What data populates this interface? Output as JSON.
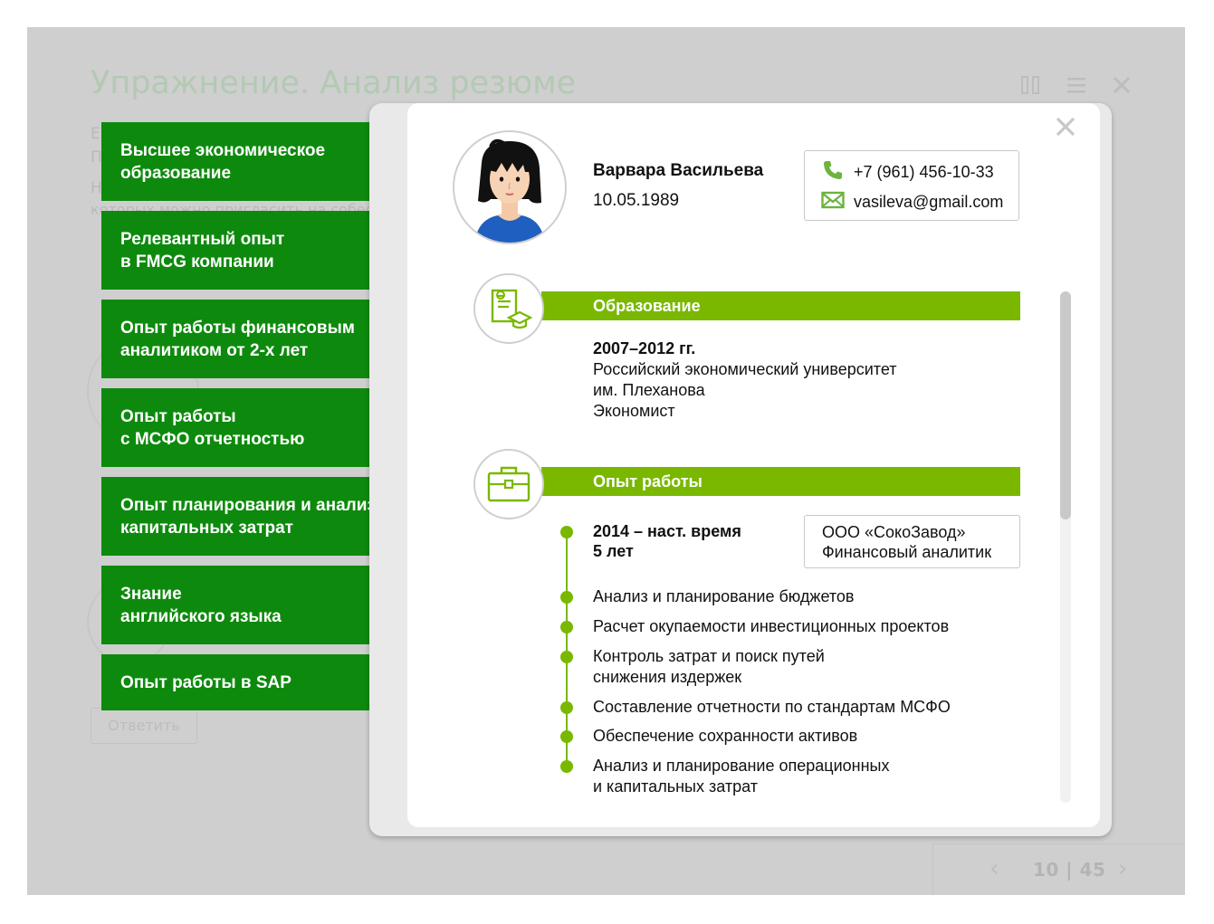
{
  "page": {
    "title": "Упражнение. Анализ резюме",
    "answer_button": "Ответить",
    "pager": "10 | 45",
    "background_text_fragments": [
      "Е",
      "П",
      "Н",
      "которых можно пригласить на собесе"
    ]
  },
  "criteria_cards": [
    {
      "lines": [
        "Высшее экономическое",
        "образование"
      ]
    },
    {
      "lines": [
        "Релевантный опыт",
        "в FMCG компании"
      ]
    },
    {
      "lines": [
        "Опыт работы финансовым",
        "аналитиком от 2-х лет"
      ]
    },
    {
      "lines": [
        "Опыт работы",
        "с МСФО отчетностью"
      ]
    },
    {
      "lines": [
        "Опыт планирования и анализа",
        "капитальных затрат"
      ]
    },
    {
      "lines": [
        "Знание",
        "английского языка"
      ]
    },
    {
      "lines": [
        "Опыт работы в SAP"
      ]
    }
  ],
  "resume": {
    "name": "Варвара Васильева",
    "birth_date": "10.05.1989",
    "phone": "+7 (961) 456-10-33",
    "email": "vasileva@gmail.com",
    "education": {
      "heading": "Образование",
      "period": "2007–2012 гг.",
      "lines": [
        "Российский экономический университет",
        "им. Плеханова",
        "Экономист"
      ]
    },
    "experience": {
      "heading": "Опыт работы",
      "period": "2014 – наст. время",
      "duration": "5 лет",
      "company": "ООО «СокоЗавод»",
      "position": "Финансовый аналитик",
      "duties": [
        {
          "lines": [
            "Анализ и планирование бюджетов"
          ]
        },
        {
          "lines": [
            "Расчет окупаемости инвестиционных проектов"
          ]
        },
        {
          "lines": [
            "Контроль затрат и поиск путей",
            "снижения издержек"
          ]
        },
        {
          "lines": [
            "Составление отчетности по стандартам МСФО"
          ]
        },
        {
          "lines": [
            "Обеспечение сохранности активов"
          ]
        },
        {
          "lines": [
            "Анализ и планирование операционных",
            "и капитальных затрат"
          ]
        }
      ]
    }
  },
  "colors": {
    "card_green": "#0d8a0d",
    "accent_green": "#7ab800",
    "overlay_gray": "#cfcfcf"
  },
  "icons": [
    "phone-icon",
    "mail-icon",
    "education-icon",
    "briefcase-icon",
    "close-icon",
    "grid-icon",
    "menu-icon",
    "prev-arrow-icon",
    "next-arrow-icon"
  ]
}
